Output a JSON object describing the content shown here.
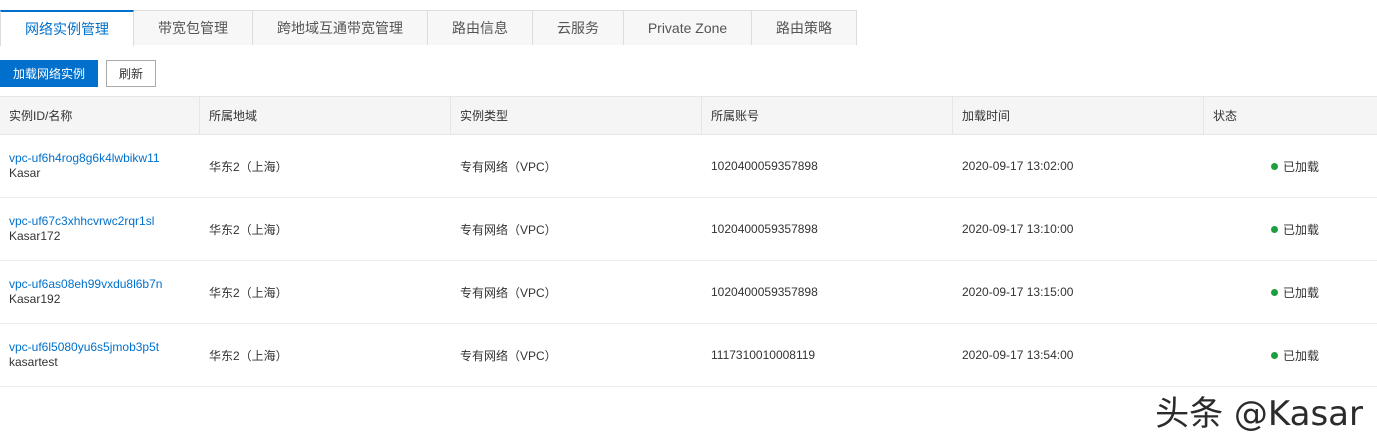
{
  "tabs": [
    {
      "label": "网络实例管理",
      "active": true
    },
    {
      "label": "带宽包管理"
    },
    {
      "label": "跨地域互通带宽管理"
    },
    {
      "label": "路由信息"
    },
    {
      "label": "云服务"
    },
    {
      "label": "Private Zone"
    },
    {
      "label": "路由策略"
    }
  ],
  "toolbar": {
    "load_label": "加载网络实例",
    "refresh_label": "刷新"
  },
  "table": {
    "headers": [
      "实例ID/名称",
      "所属地域",
      "实例类型",
      "所属账号",
      "加载时间",
      "状态"
    ],
    "rows": [
      {
        "id": "vpc-uf6h4rog8g6k4lwbikw11",
        "name": "Kasar",
        "region": "华东2（上海）",
        "type": "专有网络（VPC）",
        "account": "1020400059357898",
        "time": "2020-09-17 13:02:00",
        "status": "已加载"
      },
      {
        "id": "vpc-uf67c3xhhcvrwc2rqr1sl",
        "name": "Kasar172",
        "region": "华东2（上海）",
        "type": "专有网络（VPC）",
        "account": "1020400059357898",
        "time": "2020-09-17 13:10:00",
        "status": "已加载"
      },
      {
        "id": "vpc-uf6as08eh99vxdu8l6b7n",
        "name": "Kasar192",
        "region": "华东2（上海）",
        "type": "专有网络（VPC）",
        "account": "1020400059357898",
        "time": "2020-09-17 13:15:00",
        "status": "已加载"
      },
      {
        "id": "vpc-uf6l5080yu6s5jmob3p5t",
        "name": "kasartest",
        "region": "华东2（上海）",
        "type": "专有网络（VPC）",
        "account": "1117310010008119",
        "time": "2020-09-17 13:54:00",
        "status": "已加载"
      }
    ]
  },
  "watermark": "头条 @Kasar",
  "colors": {
    "accent": "#0070cc",
    "status_ok": "#1e9e3e"
  }
}
